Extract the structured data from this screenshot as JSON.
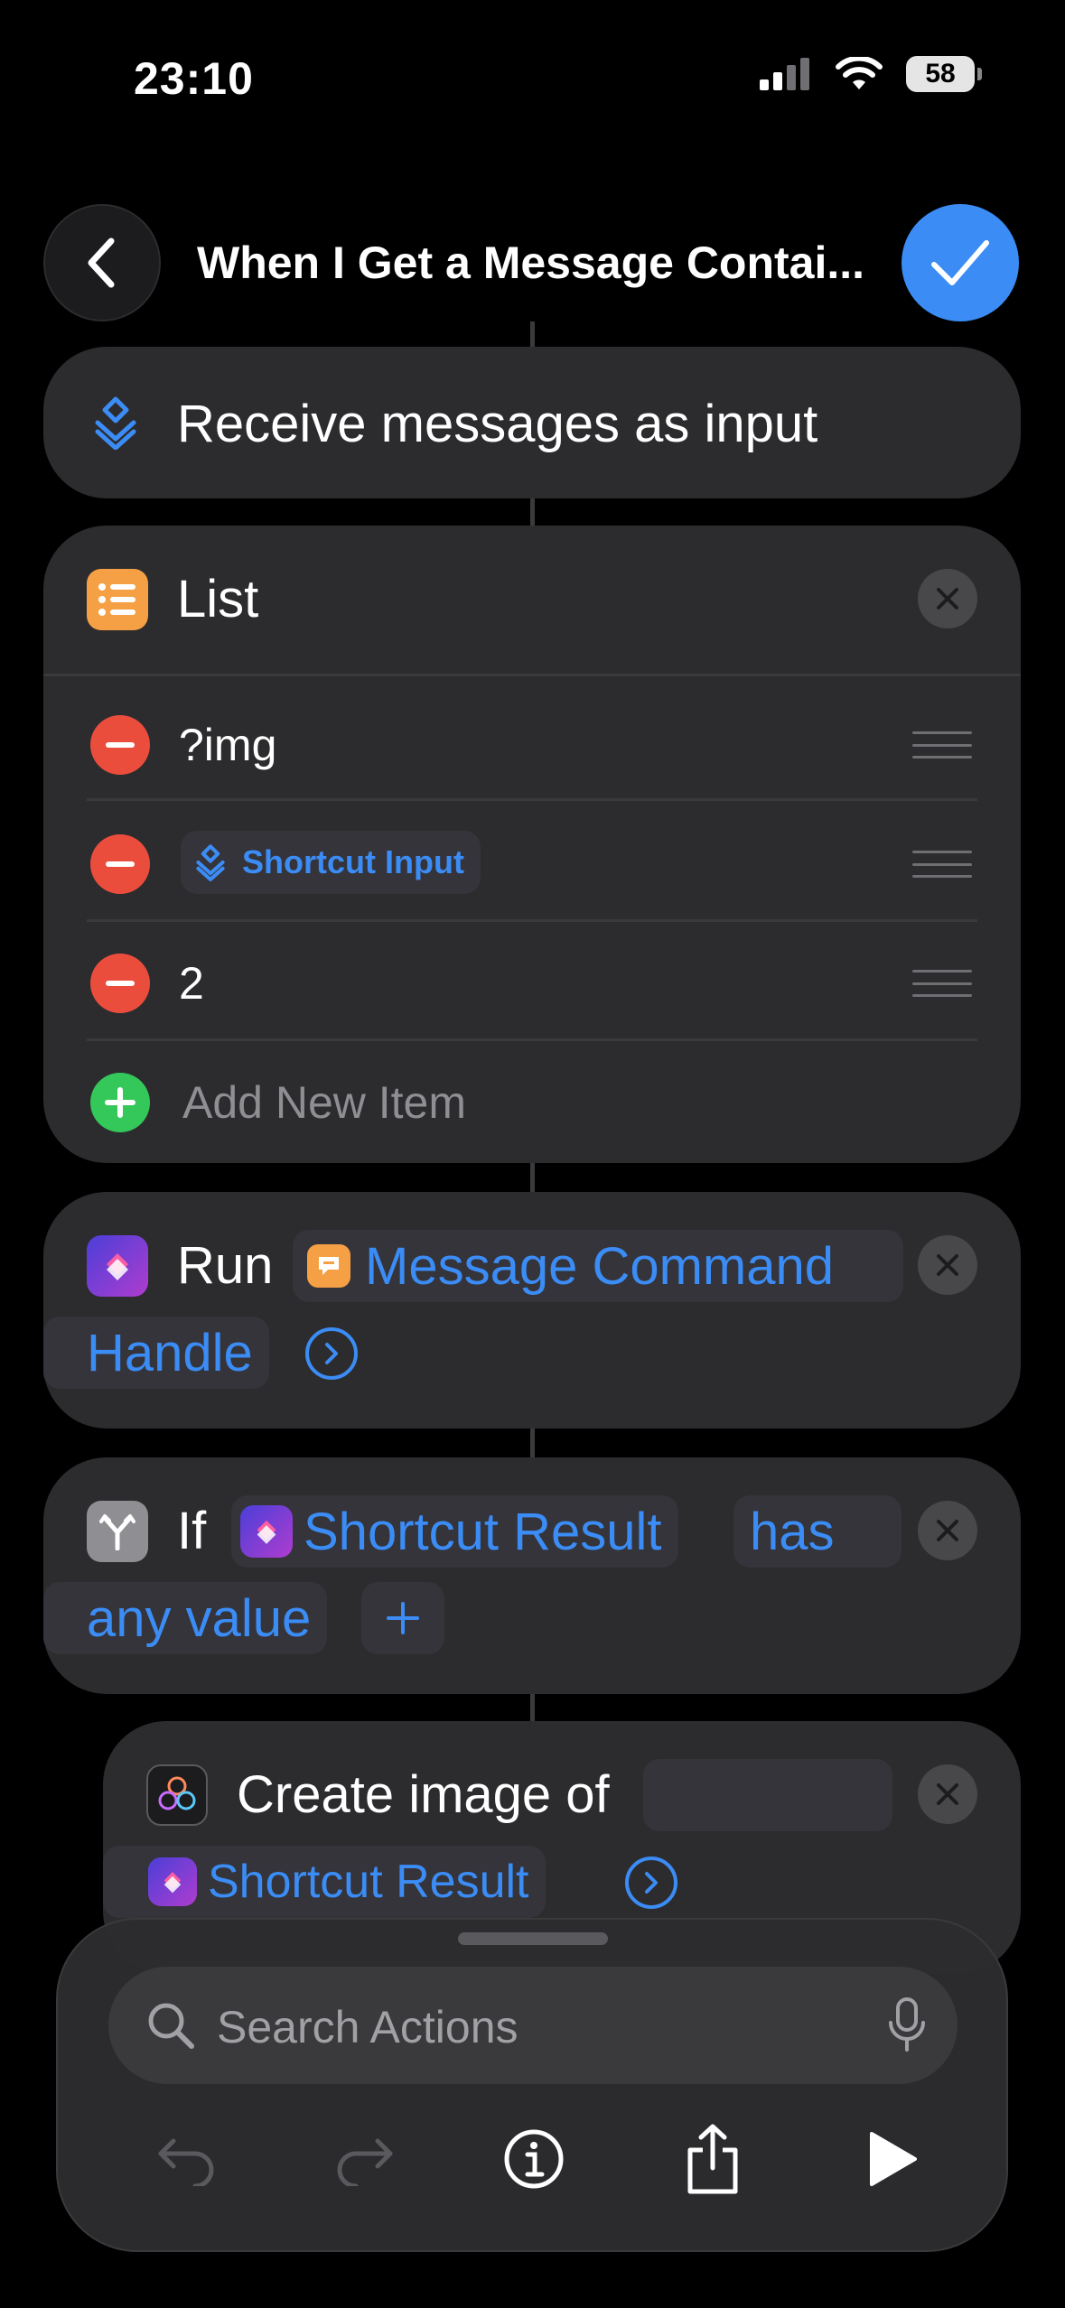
{
  "status_bar": {
    "time": "23:10",
    "battery": "58"
  },
  "nav": {
    "title": "When I Get a Message Contai..."
  },
  "receive": {
    "label": "Receive messages as input"
  },
  "list": {
    "title": "List",
    "items": [
      {
        "text": "?img"
      },
      {
        "token": "Shortcut Input"
      },
      {
        "text": "2"
      }
    ],
    "add_label": "Add New Item"
  },
  "run": {
    "verb": "Run",
    "shortcut_name_1": "Message Command",
    "shortcut_name_2": "Handle"
  },
  "if_action": {
    "verb": "If",
    "variable": "Shortcut Result",
    "condition_1": "has",
    "condition_2": "any value"
  },
  "create_image": {
    "label": "Create image of",
    "variable": "Shortcut Result"
  },
  "search": {
    "placeholder": "Search Actions"
  },
  "colors": {
    "accent": "#3b8cf5",
    "card": "#2c2c2e",
    "remove": "#eb4d3d",
    "add": "#34c759",
    "list_icon": "#f5a044"
  }
}
